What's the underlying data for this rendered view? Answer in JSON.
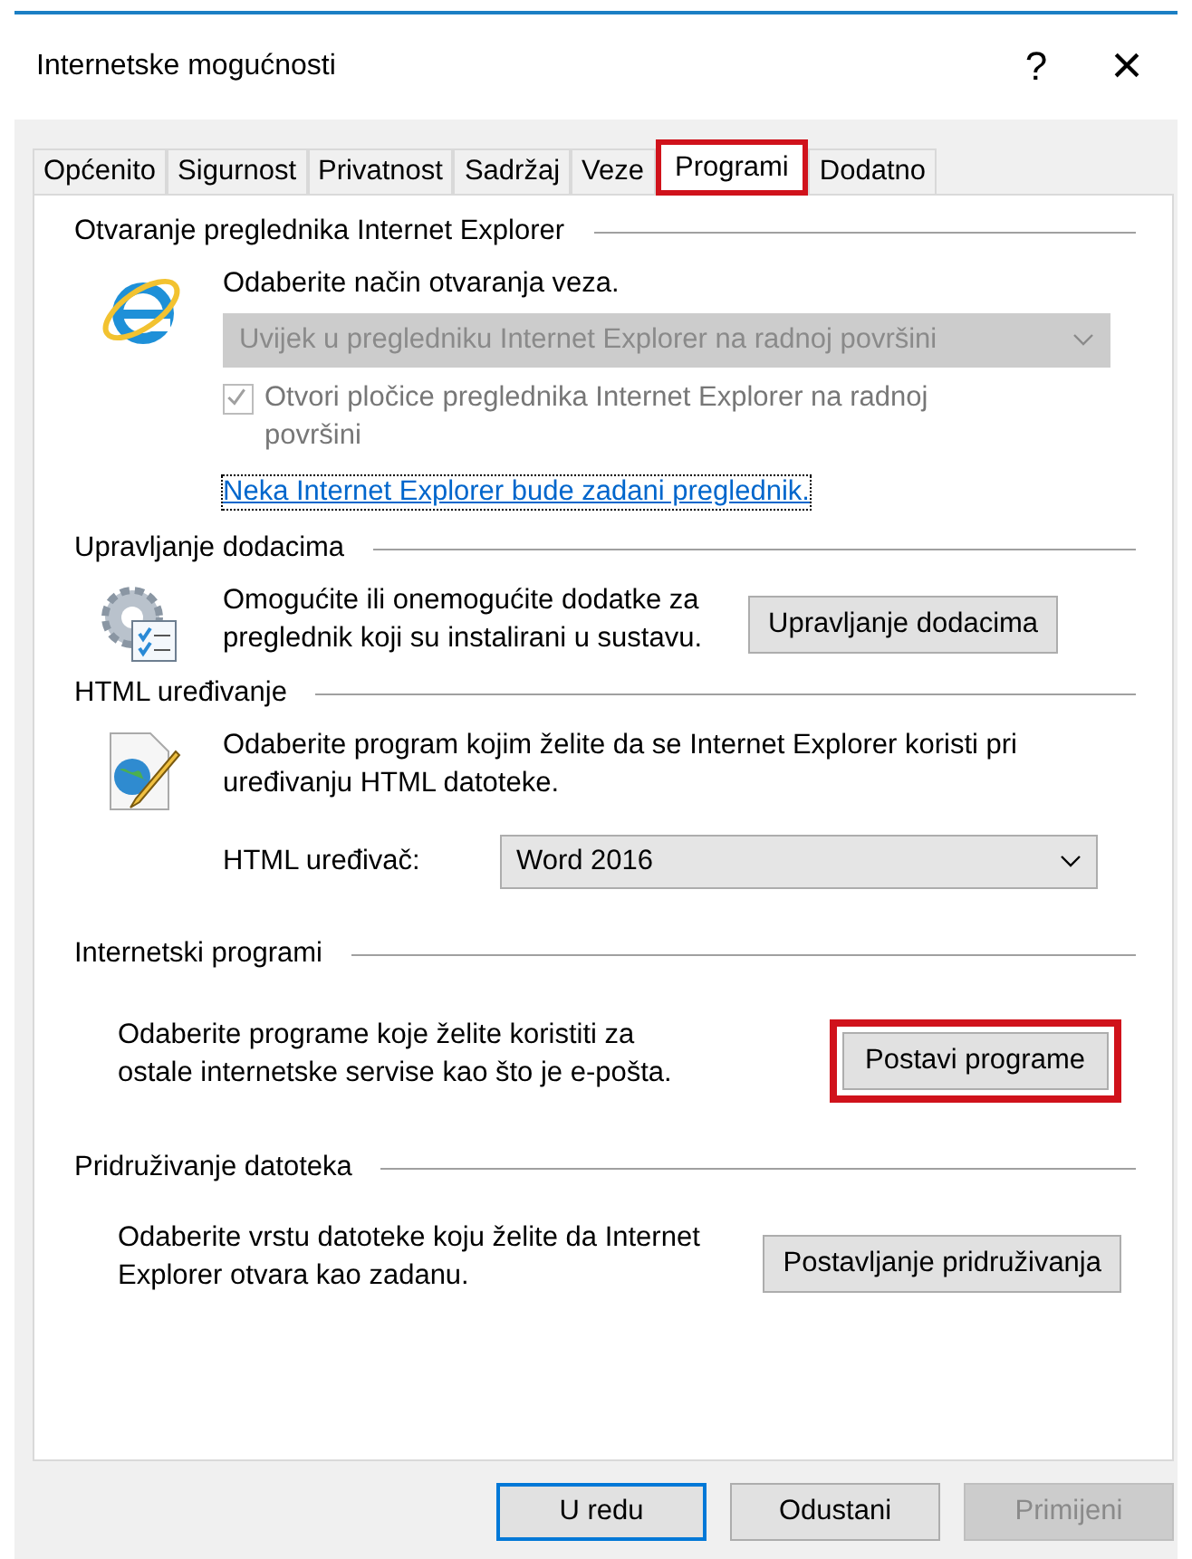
{
  "window": {
    "title": "Internetske mogućnosti",
    "help": "?",
    "close": "×"
  },
  "tabs": [
    {
      "label": "Općenito",
      "selected": false,
      "highlighted": false
    },
    {
      "label": "Sigurnost",
      "selected": false,
      "highlighted": false
    },
    {
      "label": "Privatnost",
      "selected": false,
      "highlighted": false
    },
    {
      "label": "Sadržaj",
      "selected": false,
      "highlighted": false
    },
    {
      "label": "Veze",
      "selected": false,
      "highlighted": false
    },
    {
      "label": "Programi",
      "selected": true,
      "highlighted": true
    },
    {
      "label": "Dodatno",
      "selected": false,
      "highlighted": false
    }
  ],
  "sections": [
    {
      "kind": "browser",
      "title": "Otvaranje preglednika Internet Explorer",
      "text": "Odaberite način otvaranja veza.",
      "dropdown": {
        "value": "Uvijek u pregledniku Internet Explorer na radnoj površini",
        "disabled": true
      },
      "checkbox": {
        "label": "Otvori pločice preglednika Internet Explorer na radnoj površini",
        "checked": true,
        "disabled": true
      },
      "link": "Neka Internet Explorer bude zadani preglednik."
    },
    {
      "kind": "addons",
      "title": "Upravljanje dodacima",
      "text": "Omogućite ili onemogućite dodatke za preglednik koji su instalirani u sustavu.",
      "button": {
        "label": "Upravljanje dodacima",
        "highlighted": false
      }
    },
    {
      "kind": "editor",
      "title": "HTML uređivanje",
      "text": "Odaberite program kojim želite da se Internet Explorer koristi pri uređivanju HTML datoteke.",
      "label": "HTML uređivač:",
      "dropdown": {
        "value": "Word 2016",
        "disabled": false
      }
    },
    {
      "kind": "plain",
      "title": "Internetski programi",
      "text": "Odaberite programe koje želite koristiti za ostale internetske servise kao što je e-pošta.",
      "button": {
        "label": "Postavi programe",
        "highlighted": true
      }
    },
    {
      "kind": "plain",
      "title": "Pridruživanje datoteka",
      "text": "Odaberite vrstu datoteke koju želite da Internet Explorer otvara kao zadanu.",
      "button": {
        "label": "Postavljanje pridruživanja",
        "highlighted": false
      }
    }
  ],
  "buttons": [
    {
      "label": "U redu",
      "default": true,
      "disabled": false
    },
    {
      "label": "Odustani",
      "default": false,
      "disabled": false
    },
    {
      "label": "Primijeni",
      "default": false,
      "disabled": true
    }
  ]
}
